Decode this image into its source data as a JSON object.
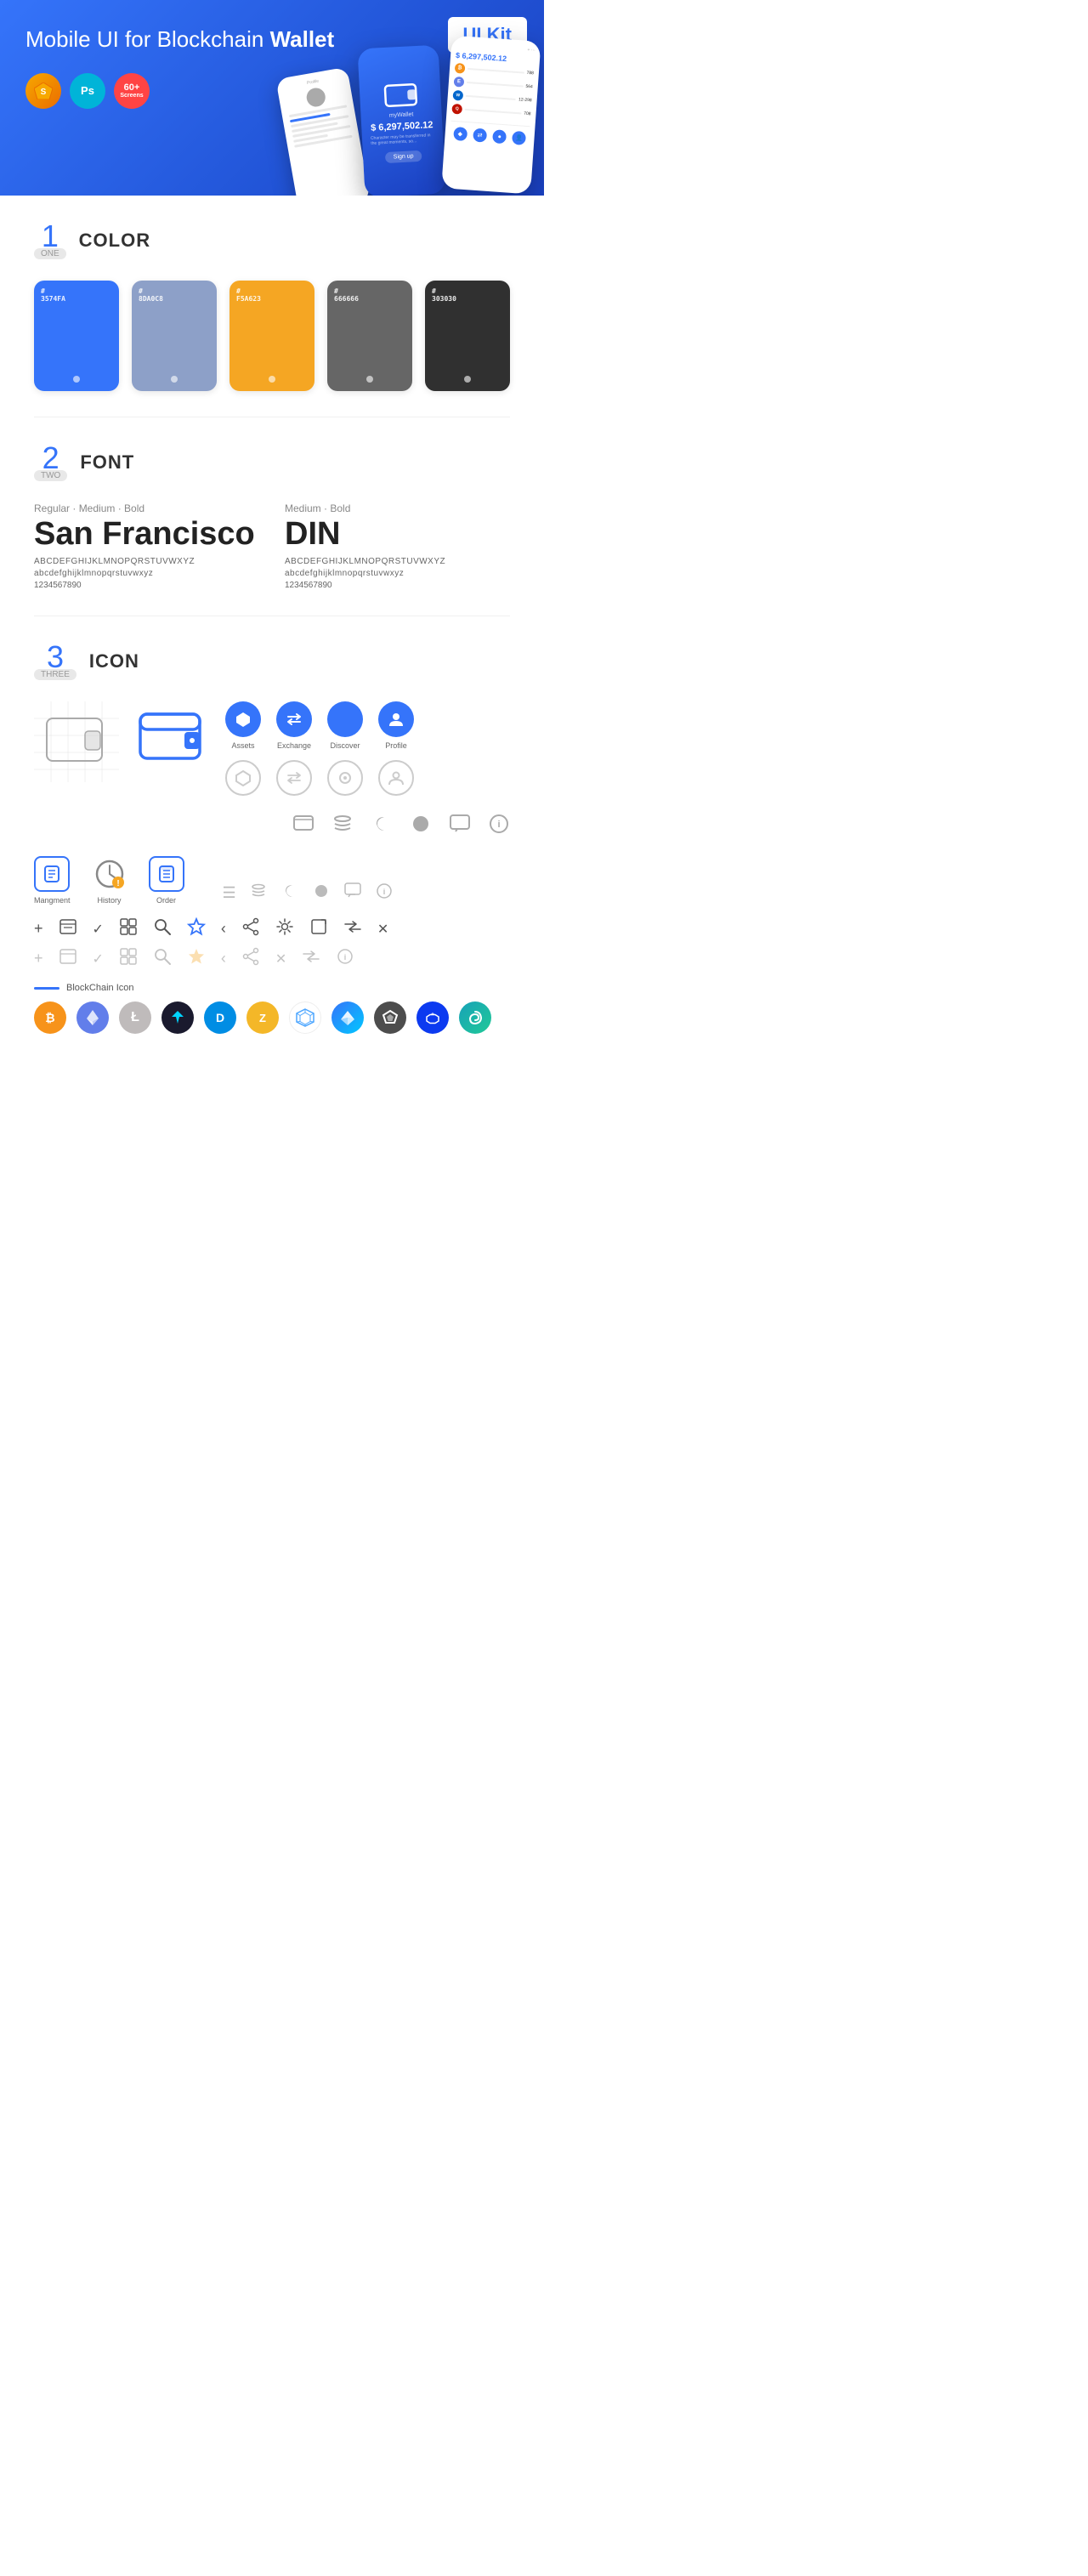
{
  "hero": {
    "title": "Mobile UI for Blockchain ",
    "title_bold": "Wallet",
    "badge": "UI Kit",
    "badges": [
      {
        "id": "sketch",
        "label": "Sk"
      },
      {
        "id": "ps",
        "label": "Ps"
      },
      {
        "id": "screens",
        "line1": "60+",
        "line2": "Screens"
      }
    ]
  },
  "sections": {
    "color": {
      "number": "1",
      "word": "ONE",
      "title": "COLOR",
      "swatches": [
        {
          "hex": "#3574FA",
          "code": "#\n3574FA"
        },
        {
          "hex": "#8DA0C8",
          "code": "#\n8DA0C8"
        },
        {
          "hex": "#F5A623",
          "code": "#\nF5A623"
        },
        {
          "hex": "#666666",
          "code": "#\n666666"
        },
        {
          "hex": "#303030",
          "code": "#\n303030"
        }
      ]
    },
    "font": {
      "number": "2",
      "word": "TWO",
      "title": "FONT",
      "fonts": [
        {
          "style": "Regular · Medium · Bold",
          "name": "San Francisco",
          "upper": "ABCDEFGHIJKLMNOPQRSTUVWXYZ",
          "lower": "abcdefghijklmnopqrstuvwxyz",
          "numbers": "1234567890"
        },
        {
          "style": "Medium · Bold",
          "name": "DIN",
          "upper": "ABCDEFGHIJKLMNOPQRSTUVWXYZ",
          "lower": "abcdefghijklmnopqrstuvwxyz",
          "numbers": "1234567890"
        }
      ]
    },
    "icon": {
      "number": "3",
      "word": "THREE",
      "title": "ICON",
      "nav_icons": [
        {
          "label": "Assets",
          "symbol": "◆"
        },
        {
          "label": "Exchange",
          "symbol": "⇄"
        },
        {
          "label": "Discover",
          "symbol": "●"
        },
        {
          "label": "Profile",
          "symbol": "👤"
        }
      ],
      "nav_icons_outline": [
        {
          "symbol": "◆"
        },
        {
          "symbol": "⇄"
        },
        {
          "symbol": "●"
        },
        {
          "symbol": "👤"
        }
      ],
      "bottom_icons": [
        {
          "label": "Mangment",
          "symbol": "☰"
        },
        {
          "label": "History",
          "symbol": "🕐"
        },
        {
          "label": "Order",
          "symbol": "📋"
        }
      ],
      "small_icons": [
        "+",
        "☰",
        "✓",
        "⊞",
        "🔍",
        "☆",
        "‹",
        "‹‹",
        "⚙",
        "⬛",
        "⇄",
        "×"
      ],
      "blockchain_label": "BlockChain Icon",
      "crypto_icons": [
        {
          "symbol": "₿",
          "bg": "#F7931A",
          "label": "Bitcoin"
        },
        {
          "symbol": "⬡",
          "bg": "#627EEA",
          "label": "Ethereum"
        },
        {
          "symbol": "Ł",
          "bg": "#BFBBBB",
          "label": "Litecoin"
        },
        {
          "symbol": "✦",
          "bg": "#1F1F2E",
          "label": "Stratis"
        },
        {
          "symbol": "D",
          "bg": "#008DE4",
          "label": "Dash"
        },
        {
          "symbol": "Z",
          "bg": "#F4B728",
          "label": "Zcash"
        },
        {
          "symbol": "⬡",
          "bg": "#48AADF",
          "label": "Grid"
        },
        {
          "symbol": "▲",
          "bg": "#2980FE",
          "label": "Ardor"
        },
        {
          "symbol": "◈",
          "bg": "#4D4D4D",
          "label": "Augur"
        },
        {
          "symbol": "◆",
          "bg": "#0C3AF0",
          "label": "Matic"
        }
      ]
    }
  }
}
